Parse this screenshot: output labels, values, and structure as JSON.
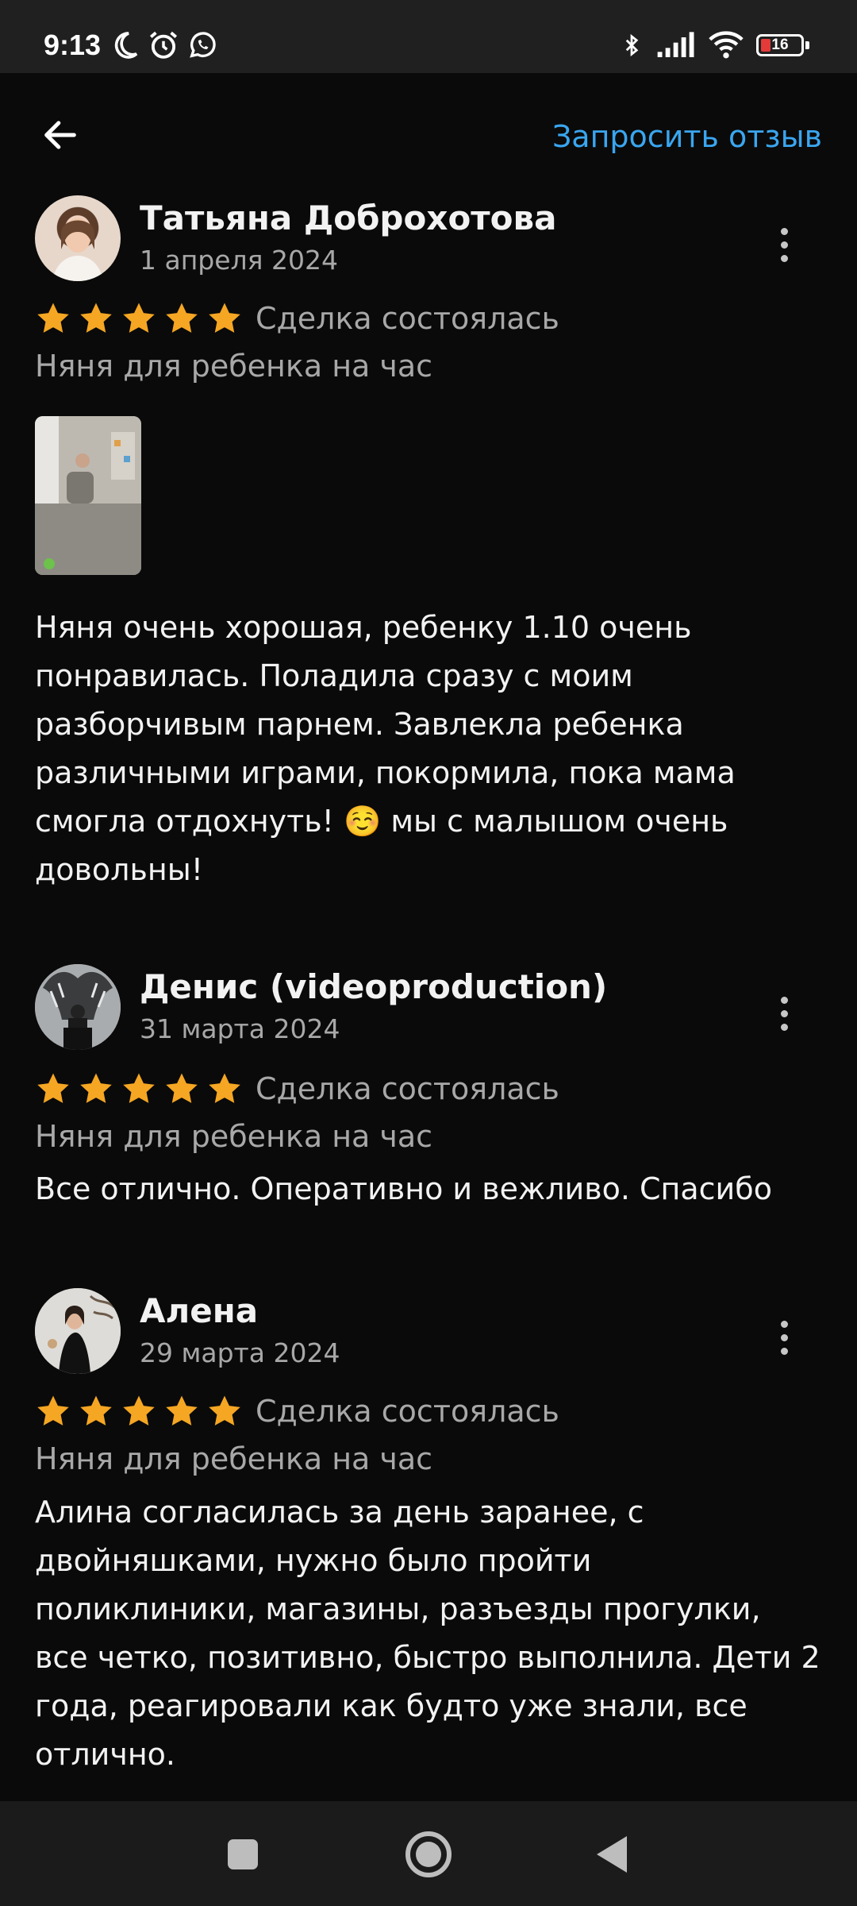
{
  "status_bar": {
    "time": "9:13",
    "battery": "16",
    "icons_left": [
      "moon-icon",
      "alarm-icon",
      "whatsapp-icon"
    ],
    "icons_right": [
      "bluetooth-icon",
      "signal-icon",
      "wifi-icon",
      "battery-icon"
    ]
  },
  "header": {
    "back_icon": "arrow-left-icon",
    "request_review": "Запросить отзыв"
  },
  "reviews": [
    {
      "author": "Татьяна Доброхотова",
      "date": "1 апреля 2024",
      "rating": 5,
      "deal_status": "Сделка состоялась",
      "service": "Няня для ребенка на час",
      "has_photo": true,
      "text": "Няня очень хорошая, ребенку 1.10 очень понравилась. Поладила сразу с моим разборчивым парнем. Завлекла ребенка различными играми, покормила, пока мама смогла отдохнуть! ☺️ мы с малышом очень довольны!"
    },
    {
      "author": "Денис (videoproduction)",
      "date": "31 марта 2024",
      "rating": 5,
      "deal_status": "Сделка состоялась",
      "service": "Няня для ребенка на час",
      "has_photo": false,
      "text": "Все отлично. Оперативно и вежливо. Спасибо"
    },
    {
      "author": "Алена",
      "date": "29 марта 2024",
      "rating": 5,
      "deal_status": "Сделка состоялась",
      "service": "Няня для ребенка на час",
      "has_photo": false,
      "text": "Алина согласилась за день заранее, с двойняшками, нужно было пройти поликлиники, магазины, разъезды прогулки, все четко, позитивно, быстро выполнила. Дети 2 года, реагировали как будто уже знали, все отлично."
    }
  ],
  "colors": {
    "background": "#0a0a0a",
    "accent_link": "#3aa6f0",
    "star": "#f5a623",
    "secondary_text": "#a8a8a8"
  },
  "nav_bar": {
    "buttons": [
      "recents-square-icon",
      "home-circle-icon",
      "back-triangle-icon"
    ]
  }
}
